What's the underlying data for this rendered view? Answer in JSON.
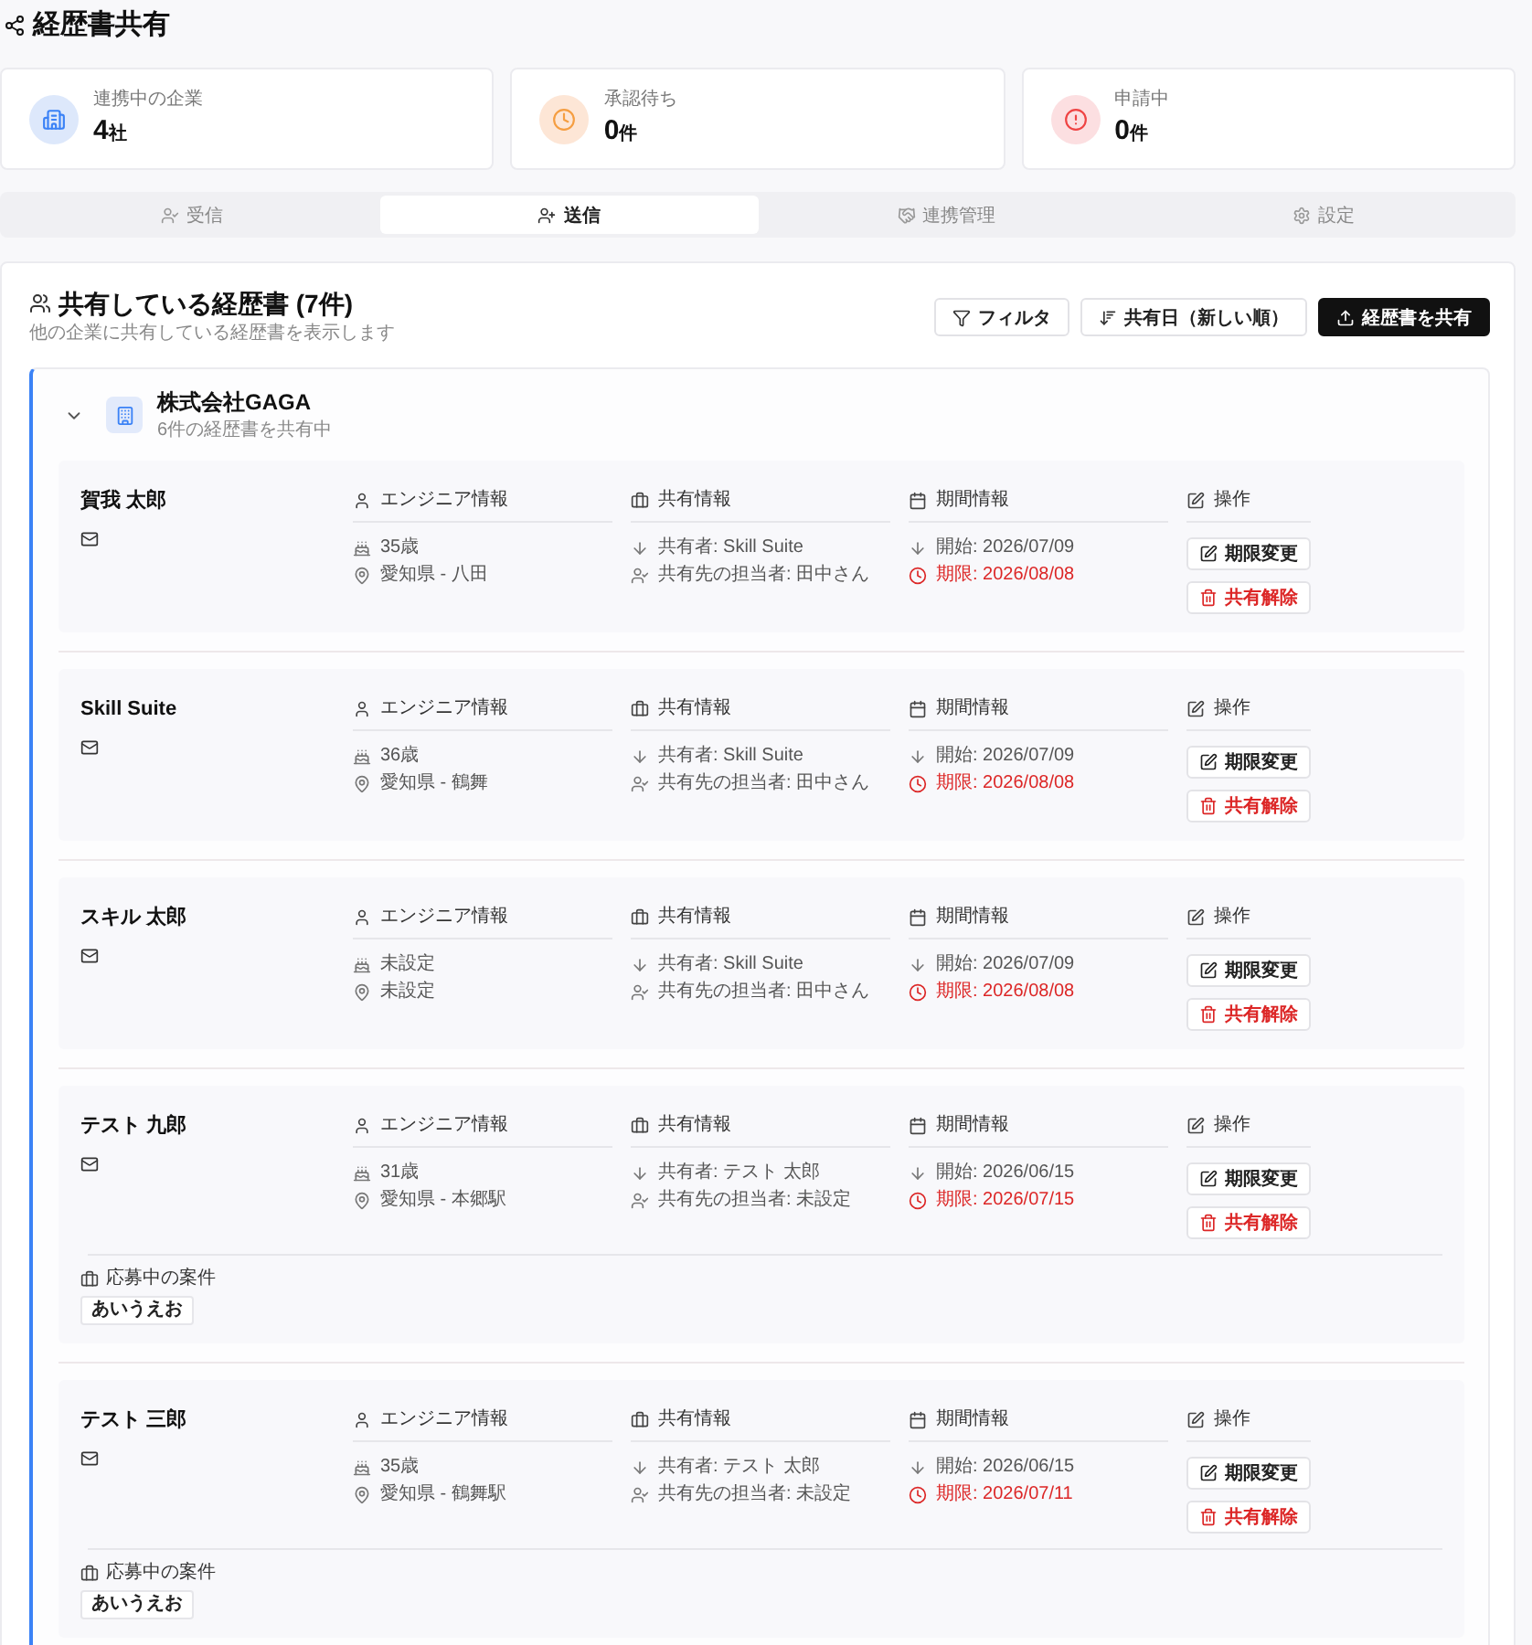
{
  "page": {
    "title": "経歴書共有"
  },
  "stats": [
    {
      "kind": "companies",
      "label": "連携中の企業",
      "value": "4",
      "unit": "社"
    },
    {
      "kind": "pending",
      "label": "承認待ち",
      "value": "0",
      "unit": "件"
    },
    {
      "kind": "requested",
      "label": "申請中",
      "value": "0",
      "unit": "件"
    }
  ],
  "tabs": [
    {
      "kind": "inbox",
      "label": "受信",
      "selected": false
    },
    {
      "kind": "sent",
      "label": "送信",
      "selected": true
    },
    {
      "kind": "links",
      "label": "連携管理",
      "selected": false
    },
    {
      "kind": "settings",
      "label": "設定",
      "selected": false
    }
  ],
  "section": {
    "title": "共有している経歴書 (7件)",
    "subtitle": "他の企業に共有している経歴書を表示します",
    "buttons": [
      {
        "kind": "filter",
        "label": "フィルタ"
      },
      {
        "kind": "sort",
        "label": "共有日（新しい順）"
      },
      {
        "kind": "primary",
        "label": "経歴書を共有"
      }
    ]
  },
  "companies": [
    {
      "name": "株式会社GAGA",
      "summary": "6件の経歴書を共有中",
      "expanded": true,
      "resumes": [
        {
          "name": "賀我 太郎",
          "sections": [
            {
              "kind": "engineer",
              "heading": "エンジニア情報",
              "items": [
                {
                  "kind": "age",
                  "text": "35歳"
                },
                {
                  "kind": "location",
                  "text": "愛知県 - 八田"
                }
              ]
            },
            {
              "kind": "sharing",
              "heading": "共有情報",
              "items": [
                {
                  "kind": "sharer",
                  "text": "共有者: Skill Suite"
                },
                {
                  "kind": "assignee",
                  "text": "共有先の担当者: 田中さん"
                }
              ]
            },
            {
              "kind": "period",
              "heading": "期間情報",
              "items": [
                {
                  "kind": "start",
                  "text": "開始: 2026/07/09"
                },
                {
                  "kind": "deadline",
                  "text": "期限: 2026/08/08"
                }
              ]
            },
            {
              "kind": "actions",
              "heading": "操作",
              "buttons": [
                {
                  "kind": "edit",
                  "label": "期限変更"
                },
                {
                  "kind": "delete",
                  "label": "共有解除"
                }
              ]
            }
          ]
        },
        {
          "name": "Skill Suite",
          "sections": [
            {
              "kind": "engineer",
              "heading": "エンジニア情報",
              "items": [
                {
                  "kind": "age",
                  "text": "36歳"
                },
                {
                  "kind": "location",
                  "text": "愛知県 - 鶴舞"
                }
              ]
            },
            {
              "kind": "sharing",
              "heading": "共有情報",
              "items": [
                {
                  "kind": "sharer",
                  "text": "共有者: Skill Suite"
                },
                {
                  "kind": "assignee",
                  "text": "共有先の担当者: 田中さん"
                }
              ]
            },
            {
              "kind": "period",
              "heading": "期間情報",
              "items": [
                {
                  "kind": "start",
                  "text": "開始: 2026/07/09"
                },
                {
                  "kind": "deadline",
                  "text": "期限: 2026/08/08"
                }
              ]
            },
            {
              "kind": "actions",
              "heading": "操作",
              "buttons": [
                {
                  "kind": "edit",
                  "label": "期限変更"
                },
                {
                  "kind": "delete",
                  "label": "共有解除"
                }
              ]
            }
          ]
        },
        {
          "name": "スキル 太郎",
          "sections": [
            {
              "kind": "engineer",
              "heading": "エンジニア情報",
              "items": [
                {
                  "kind": "age",
                  "text": "未設定"
                },
                {
                  "kind": "location",
                  "text": "未設定"
                }
              ]
            },
            {
              "kind": "sharing",
              "heading": "共有情報",
              "items": [
                {
                  "kind": "sharer",
                  "text": "共有者: Skill Suite"
                },
                {
                  "kind": "assignee",
                  "text": "共有先の担当者: 田中さん"
                }
              ]
            },
            {
              "kind": "period",
              "heading": "期間情報",
              "items": [
                {
                  "kind": "start",
                  "text": "開始: 2026/07/09"
                },
                {
                  "kind": "deadline",
                  "text": "期限: 2026/08/08"
                }
              ]
            },
            {
              "kind": "actions",
              "heading": "操作",
              "buttons": [
                {
                  "kind": "edit",
                  "label": "期限変更"
                },
                {
                  "kind": "delete",
                  "label": "共有解除"
                }
              ]
            }
          ]
        },
        {
          "name": "テスト 九郎",
          "sections": [
            {
              "kind": "engineer",
              "heading": "エンジニア情報",
              "items": [
                {
                  "kind": "age",
                  "text": "31歳"
                },
                {
                  "kind": "location",
                  "text": "愛知県 - 本郷駅"
                }
              ]
            },
            {
              "kind": "sharing",
              "heading": "共有情報",
              "items": [
                {
                  "kind": "sharer",
                  "text": "共有者: テスト 太郎"
                },
                {
                  "kind": "assignee",
                  "text": "共有先の担当者: 未設定"
                }
              ]
            },
            {
              "kind": "period",
              "heading": "期間情報",
              "items": [
                {
                  "kind": "start",
                  "text": "開始: 2026/06/15"
                },
                {
                  "kind": "deadline",
                  "text": "期限: 2026/07/15"
                }
              ]
            },
            {
              "kind": "actions",
              "heading": "操作",
              "buttons": [
                {
                  "kind": "edit",
                  "label": "期限変更"
                },
                {
                  "kind": "delete",
                  "label": "共有解除"
                }
              ]
            }
          ],
          "applications": {
            "heading": "応募中の案件",
            "tags": [
              "あいうえお"
            ]
          }
        },
        {
          "name": "テスト 三郎",
          "sections": [
            {
              "kind": "engineer",
              "heading": "エンジニア情報",
              "items": [
                {
                  "kind": "age",
                  "text": "35歳"
                },
                {
                  "kind": "location",
                  "text": "愛知県 - 鶴舞駅"
                }
              ]
            },
            {
              "kind": "sharing",
              "heading": "共有情報",
              "items": [
                {
                  "kind": "sharer",
                  "text": "共有者: テスト 太郎"
                },
                {
                  "kind": "assignee",
                  "text": "共有先の担当者: 未設定"
                }
              ]
            },
            {
              "kind": "period",
              "heading": "期間情報",
              "items": [
                {
                  "kind": "start",
                  "text": "開始: 2026/06/15"
                },
                {
                  "kind": "deadline",
                  "text": "期限: 2026/07/11"
                }
              ]
            },
            {
              "kind": "actions",
              "heading": "操作",
              "buttons": [
                {
                  "kind": "edit",
                  "label": "期限変更"
                },
                {
                  "kind": "delete",
                  "label": "共有解除"
                }
              ]
            }
          ],
          "applications": {
            "heading": "応募中の案件",
            "tags": [
              "あいうえお"
            ]
          }
        }
      ]
    }
  ]
}
